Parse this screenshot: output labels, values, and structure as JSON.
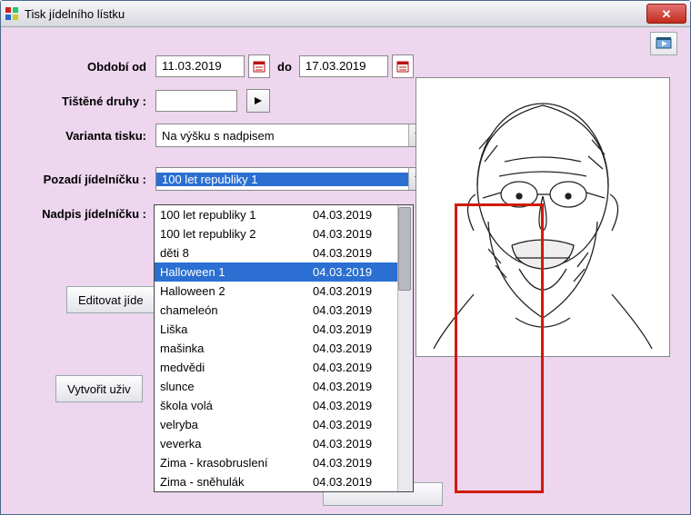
{
  "window": {
    "title": "Tisk jídelního lístku"
  },
  "labels": {
    "obdobi_od": "Období od",
    "do": "do",
    "tistene_druhy": "Tištěné druhy :",
    "varianta_tisku": "Varianta tisku:",
    "pozadi": "Pozadí jídelníčku :",
    "nadpis": "Nadpis jídelníčku :"
  },
  "values": {
    "date_from": "11.03.2019",
    "date_to": "17.03.2019",
    "tistene_druhy": "",
    "varianta_tisku": "Na výšku s nadpisem",
    "pozadi_selected": "100 let republiky 1"
  },
  "buttons": {
    "edit": "Editovat jíde",
    "create": "Vytvořit uživ"
  },
  "dropdown": {
    "selected_index": 3,
    "items": [
      {
        "name": "100 let republiky 1",
        "date": "04.03.2019"
      },
      {
        "name": "100 let republiky 2",
        "date": "04.03.2019"
      },
      {
        "name": "děti 8",
        "date": "04.03.2019"
      },
      {
        "name": "Halloween 1",
        "date": "04.03.2019"
      },
      {
        "name": "Halloween 2",
        "date": "04.03.2019"
      },
      {
        "name": "chameleón",
        "date": "04.03.2019"
      },
      {
        "name": "Liška",
        "date": "04.03.2019"
      },
      {
        "name": "mašinka",
        "date": "04.03.2019"
      },
      {
        "name": "medvědi",
        "date": "04.03.2019"
      },
      {
        "name": "slunce",
        "date": "04.03.2019"
      },
      {
        "name": "škola volá",
        "date": "04.03.2019"
      },
      {
        "name": "velryba",
        "date": "04.03.2019"
      },
      {
        "name": "veverka",
        "date": "04.03.2019"
      },
      {
        "name": "Zima - krasobruslení",
        "date": "04.03.2019"
      },
      {
        "name": "Zima - sněhulák",
        "date": "04.03.2019"
      }
    ]
  }
}
